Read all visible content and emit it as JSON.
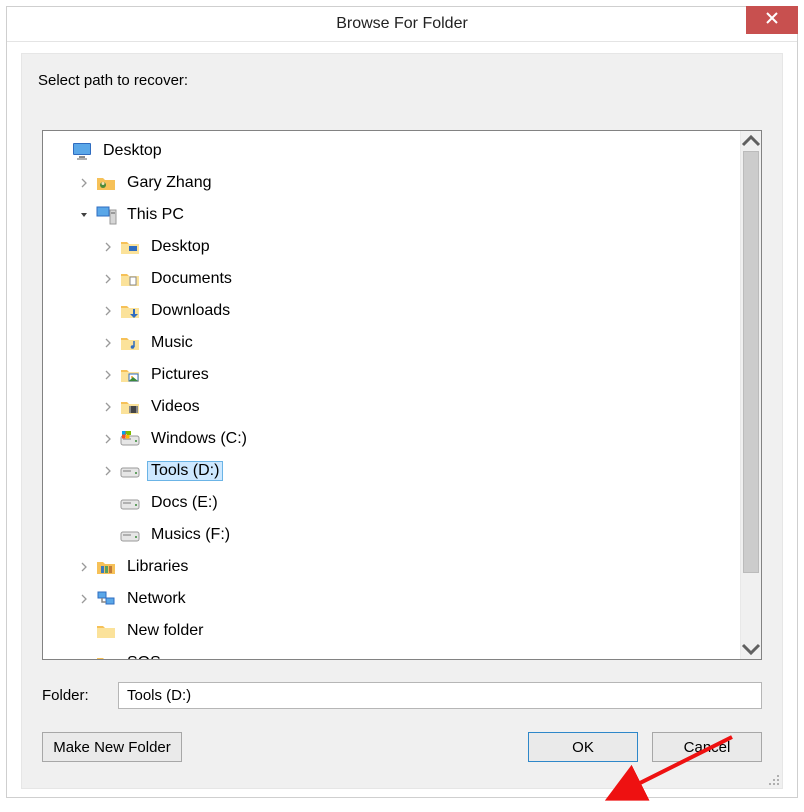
{
  "dialog": {
    "title": "Browse For Folder",
    "instruction": "Select path to recover:",
    "folder_label": "Folder:",
    "folder_value": "Tools (D:)",
    "buttons": {
      "make_new": "Make New Folder",
      "ok": "OK",
      "cancel": "Cancel"
    }
  },
  "tree": {
    "items": [
      {
        "label": "Desktop",
        "indent": 0,
        "expander": "none",
        "icon": "monitor",
        "selected": false
      },
      {
        "label": "Gary Zhang",
        "indent": 1,
        "expander": "right",
        "icon": "user-folder",
        "selected": false
      },
      {
        "label": "This PC",
        "indent": 1,
        "expander": "down",
        "icon": "pc",
        "selected": false
      },
      {
        "label": "Desktop",
        "indent": 2,
        "expander": "right",
        "icon": "folder-desktop",
        "selected": false
      },
      {
        "label": "Documents",
        "indent": 2,
        "expander": "right",
        "icon": "folder-docs",
        "selected": false
      },
      {
        "label": "Downloads",
        "indent": 2,
        "expander": "right",
        "icon": "folder-down",
        "selected": false
      },
      {
        "label": "Music",
        "indent": 2,
        "expander": "right",
        "icon": "folder-music",
        "selected": false
      },
      {
        "label": "Pictures",
        "indent": 2,
        "expander": "right",
        "icon": "folder-pics",
        "selected": false
      },
      {
        "label": "Videos",
        "indent": 2,
        "expander": "right",
        "icon": "folder-video",
        "selected": false
      },
      {
        "label": "Windows (C:)",
        "indent": 2,
        "expander": "right",
        "icon": "drive-win",
        "selected": false
      },
      {
        "label": "Tools (D:)",
        "indent": 2,
        "expander": "right",
        "icon": "drive",
        "selected": true
      },
      {
        "label": "Docs (E:)",
        "indent": 2,
        "expander": "none",
        "icon": "drive",
        "selected": false
      },
      {
        "label": "Musics (F:)",
        "indent": 2,
        "expander": "none",
        "icon": "drive",
        "selected": false
      },
      {
        "label": "Libraries",
        "indent": 1,
        "expander": "right",
        "icon": "libraries",
        "selected": false
      },
      {
        "label": "Network",
        "indent": 1,
        "expander": "right",
        "icon": "network",
        "selected": false
      },
      {
        "label": "New folder",
        "indent": 1,
        "expander": "none",
        "icon": "folder",
        "selected": false
      },
      {
        "label": "SOS",
        "indent": 1,
        "expander": "none",
        "icon": "folder",
        "selected": false
      }
    ]
  },
  "icons": {
    "close": "close-icon",
    "chevron_right": "chevron-right-icon",
    "chevron_down": "chevron-down-icon",
    "scroll_up": "scroll-up-icon",
    "scroll_down": "scroll-down-icon",
    "resize": "resize-grip-icon"
  }
}
